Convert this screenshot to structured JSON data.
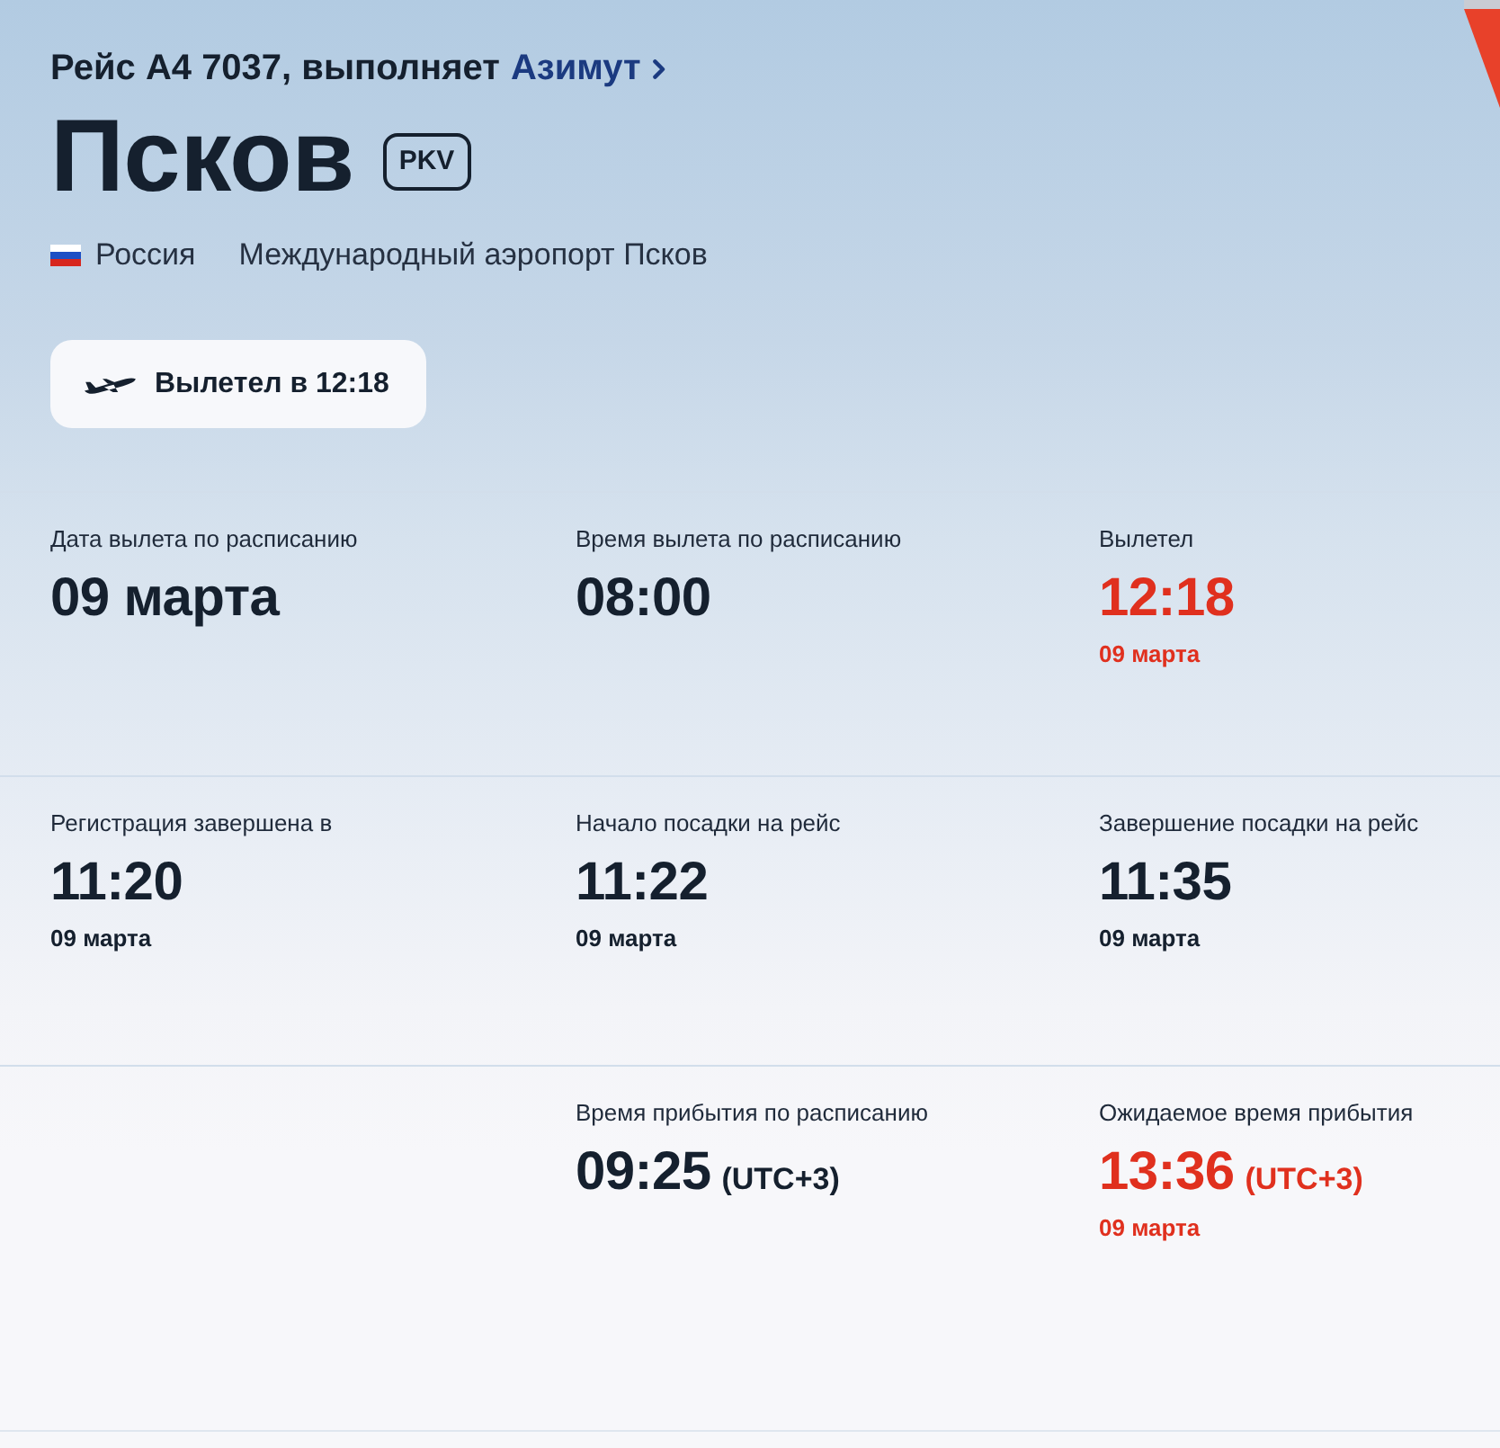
{
  "header": {
    "flight": "Рейс А4 7037, выполняет",
    "carrier": "Азимут",
    "city": "Псков",
    "iata": "PKV",
    "country": "Россия",
    "airport": "Международный аэропорт Псков",
    "status": "Вылетел в 12:18"
  },
  "rows": [
    {
      "cells": [
        {
          "label": "Дата вылета по расписанию",
          "value": "09 марта",
          "delayed": false
        },
        {
          "label": "Время вылета по расписанию",
          "value": "08:00",
          "delayed": false
        },
        {
          "label": "Вылетел",
          "value": "12:18",
          "date": "09 марта",
          "delayed": true
        }
      ]
    },
    {
      "cells": [
        {
          "label": "Регистрация завершена в",
          "value": "11:20",
          "date": "09 марта",
          "delayed": false
        },
        {
          "label": "Начало посадки на рейс",
          "value": "11:22",
          "date": "09 марта",
          "delayed": false
        },
        {
          "label": "Завершение посадки на рейс",
          "value": "11:35",
          "date": "09 марта",
          "delayed": false
        }
      ]
    },
    {
      "cells": [
        null,
        {
          "label": "Время прибытия по расписанию",
          "value": "09:25",
          "zone": "(UTC+3)",
          "delayed": false
        },
        {
          "label": "Ожидаемое время прибытия",
          "value": "13:36",
          "zone": "(UTC+3)",
          "date": "09 марта",
          "delayed": true
        }
      ]
    }
  ]
}
